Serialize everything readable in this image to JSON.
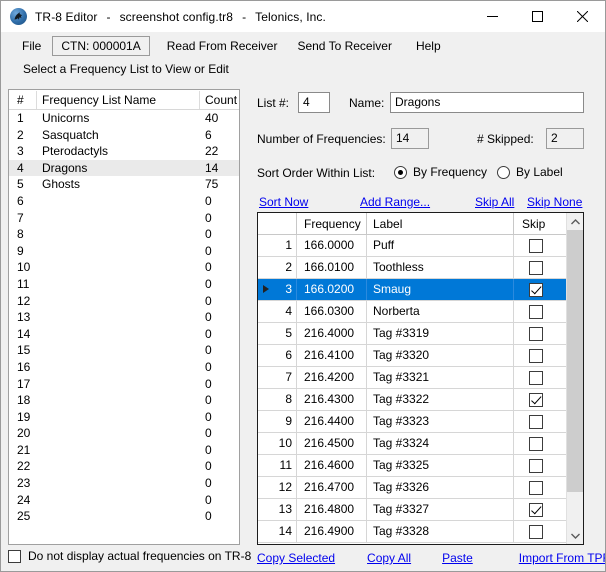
{
  "window": {
    "title_app": "TR-8 Editor",
    "title_file": "screenshot config.tr8",
    "title_company": "Telonics, Inc.",
    "separator": "-",
    "icon": "telonics-raven-icon",
    "minimize": "minimize-icon",
    "maximize": "maximize-icon",
    "close": "close-icon"
  },
  "menubar": {
    "file": "File",
    "ctn": "CTN:  000001A",
    "read_from_receiver": "Read From Receiver",
    "send_to_receiver": "Send To Receiver",
    "help": "Help"
  },
  "left_panel": {
    "caption": "Select a Frequency List to View or Edit",
    "headers": {
      "num": "#",
      "name": "Frequency List Name",
      "count": "Count"
    },
    "rows": [
      {
        "num": "1",
        "name": "Unicorns",
        "count": "40",
        "selected": false
      },
      {
        "num": "2",
        "name": "Sasquatch",
        "count": "6",
        "selected": false
      },
      {
        "num": "3",
        "name": "Pterodactyls",
        "count": "22",
        "selected": false
      },
      {
        "num": "4",
        "name": "Dragons",
        "count": "14",
        "selected": true
      },
      {
        "num": "5",
        "name": "Ghosts",
        "count": "75",
        "selected": false
      },
      {
        "num": "6",
        "name": "",
        "count": "0",
        "selected": false
      },
      {
        "num": "7",
        "name": "",
        "count": "0",
        "selected": false
      },
      {
        "num": "8",
        "name": "",
        "count": "0",
        "selected": false
      },
      {
        "num": "9",
        "name": "",
        "count": "0",
        "selected": false
      },
      {
        "num": "10",
        "name": "",
        "count": "0",
        "selected": false
      },
      {
        "num": "11",
        "name": "",
        "count": "0",
        "selected": false
      },
      {
        "num": "12",
        "name": "",
        "count": "0",
        "selected": false
      },
      {
        "num": "13",
        "name": "",
        "count": "0",
        "selected": false
      },
      {
        "num": "14",
        "name": "",
        "count": "0",
        "selected": false
      },
      {
        "num": "15",
        "name": "",
        "count": "0",
        "selected": false
      },
      {
        "num": "16",
        "name": "",
        "count": "0",
        "selected": false
      },
      {
        "num": "17",
        "name": "",
        "count": "0",
        "selected": false
      },
      {
        "num": "18",
        "name": "",
        "count": "0",
        "selected": false
      },
      {
        "num": "19",
        "name": "",
        "count": "0",
        "selected": false
      },
      {
        "num": "20",
        "name": "",
        "count": "0",
        "selected": false
      },
      {
        "num": "21",
        "name": "",
        "count": "0",
        "selected": false
      },
      {
        "num": "22",
        "name": "",
        "count": "0",
        "selected": false
      },
      {
        "num": "23",
        "name": "",
        "count": "0",
        "selected": false
      },
      {
        "num": "24",
        "name": "",
        "count": "0",
        "selected": false
      },
      {
        "num": "25",
        "name": "",
        "count": "0",
        "selected": false
      }
    ],
    "do_not_display_label": "Do not display actual frequencies on TR-8",
    "do_not_display_checked": false
  },
  "form": {
    "list_num_label": "List #:",
    "list_num_value": "4",
    "name_label": "Name:",
    "name_value": "Dragons",
    "number_of_frequencies_label": "Number of Frequencies:",
    "number_of_frequencies_value": "14",
    "skipped_label": "# Skipped:",
    "skipped_value": "2",
    "sort_order_label": "Sort Order Within List:",
    "by_frequency_label": "By Frequency",
    "by_label_label": "By Label",
    "sort_selected": "By Frequency",
    "links": {
      "sort_now": "Sort Now",
      "add_range": "Add Range...",
      "skip_all": "Skip All",
      "skip_none": "Skip None"
    }
  },
  "grid": {
    "headers": {
      "row": "",
      "frequency": "Frequency",
      "label": "Label",
      "skip": "Skip"
    },
    "rows": [
      {
        "num": "1",
        "frequency": "166.0000",
        "label": "Puff",
        "skip": false,
        "selected": false
      },
      {
        "num": "2",
        "frequency": "166.0100",
        "label": "Toothless",
        "skip": false,
        "selected": false
      },
      {
        "num": "3",
        "frequency": "166.0200",
        "label": "Smaug",
        "skip": true,
        "selected": true
      },
      {
        "num": "4",
        "frequency": "166.0300",
        "label": "Norberta",
        "skip": false,
        "selected": false
      },
      {
        "num": "5",
        "frequency": "216.4000",
        "label": "Tag #3319",
        "skip": false,
        "selected": false
      },
      {
        "num": "6",
        "frequency": "216.4100",
        "label": "Tag #3320",
        "skip": false,
        "selected": false
      },
      {
        "num": "7",
        "frequency": "216.4200",
        "label": "Tag #3321",
        "skip": false,
        "selected": false
      },
      {
        "num": "8",
        "frequency": "216.4300",
        "label": "Tag #3322",
        "skip": true,
        "selected": false
      },
      {
        "num": "9",
        "frequency": "216.4400",
        "label": "Tag #3323",
        "skip": false,
        "selected": false
      },
      {
        "num": "10",
        "frequency": "216.4500",
        "label": "Tag #3324",
        "skip": false,
        "selected": false
      },
      {
        "num": "11",
        "frequency": "216.4600",
        "label": "Tag #3325",
        "skip": false,
        "selected": false
      },
      {
        "num": "12",
        "frequency": "216.4700",
        "label": "Tag #3326",
        "skip": false,
        "selected": false
      },
      {
        "num": "13",
        "frequency": "216.4800",
        "label": "Tag #3327",
        "skip": true,
        "selected": false
      },
      {
        "num": "14",
        "frequency": "216.4900",
        "label": "Tag #3328",
        "skip": false,
        "selected": false
      }
    ],
    "scrollbar": {
      "up": "scroll-up-icon",
      "down": "scroll-down-icon"
    }
  },
  "bottom_links": {
    "copy_selected": "Copy Selected",
    "copy_all": "Copy All",
    "paste": "Paste",
    "import_from_tpf": "Import From TPF File..."
  },
  "colors": {
    "selection_blue": "#0078d7",
    "list_selection_gray": "#eaeaea",
    "link_blue": "#0000ee",
    "window_chrome": "#f0f0f0"
  }
}
